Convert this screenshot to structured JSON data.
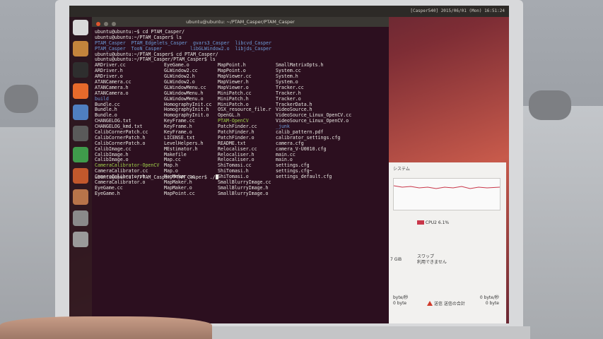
{
  "topbar": {
    "status": "[Casper540] 2015/06/01 (Mon) 16:51:24"
  },
  "launcher": {
    "items": [
      "ubuntu-logo-icon",
      "files-icon",
      "terminal-icon",
      "firefox-icon",
      "libreoffice-writer-icon",
      "system-monitor-icon",
      "libreoffice-calc-icon",
      "libreoffice-impress-icon",
      "software-center-icon",
      "settings-icon",
      "trash-icon"
    ],
    "colors": [
      "#d9d9d9",
      "#c3843c",
      "#2e2e2e",
      "#e66a2b",
      "#4f7fc1",
      "#5a5a5a",
      "#3f9b4b",
      "#c2582c",
      "#b8744a",
      "#8a8a8a",
      "#9a9a9a"
    ]
  },
  "terminal": {
    "title": "ubuntu@ubuntu: ~/PTAM_Casper/PTAM_Casper",
    "lines_top": [
      "ubuntu@ubuntu:~$ cd PTAM_Casper/",
      "ubuntu@ubuntu:~/PTAM_Casper$ ls"
    ],
    "ls1": [
      {
        "text": "PTAM_Casper  PTAM_Edgelets_Casper  gvars3_Casper  libcvd_Casper",
        "cls": "blue"
      },
      {
        "text": "PTAM_Casper  TooN_Casper          libGLWindow2.o  libjds_Casper",
        "cls": "blue"
      }
    ],
    "lines_mid": [
      "ubuntu@ubuntu:~/PTAM_Casper$ cd PTAM_Casper/",
      "ubuntu@ubuntu:~/PTAM_Casper/PTAM_Casper$ ls"
    ],
    "columns": [
      [
        {
          "t": "ARDriver.cc"
        },
        {
          "t": "ARDriver.h"
        },
        {
          "t": "ARDriver.o"
        },
        {
          "t": "ATANCamera.cc"
        },
        {
          "t": "ATANCamera.h"
        },
        {
          "t": "ATANCamera.o"
        },
        {
          "t": "build",
          "c": "blue"
        },
        {
          "t": "Bundle.cc"
        },
        {
          "t": "Bundle.h"
        },
        {
          "t": "Bundle.o"
        },
        {
          "t": "CHANGELOG.txt"
        },
        {
          "t": "CHANGELOG_kmd.txt"
        },
        {
          "t": "CalibCornerPatch.cc"
        },
        {
          "t": "CalibCornerPatch.h"
        },
        {
          "t": "CalibCornerPatch.o"
        },
        {
          "t": "CalibImage.cc"
        },
        {
          "t": "CalibImage.h"
        },
        {
          "t": "CalibImage.o"
        },
        {
          "t": "CameraCalibrator-OpenCV",
          "c": "green"
        },
        {
          "t": "CameraCalibrator.cc"
        },
        {
          "t": "CameraCalibrator.h"
        },
        {
          "t": "CameraCalibrator.o"
        },
        {
          "t": "EyeGame.cc"
        },
        {
          "t": "EyeGame.h"
        }
      ],
      [
        {
          "t": "EyeGame.o"
        },
        {
          "t": "GLWindow2.cc"
        },
        {
          "t": "GLWindow2.h"
        },
        {
          "t": "GLWindow2.o"
        },
        {
          "t": "GLWindowMenu.cc"
        },
        {
          "t": "GLWindowMenu.h"
        },
        {
          "t": "GLWindowMenu.o"
        },
        {
          "t": "HomographyInit.cc"
        },
        {
          "t": "HomographyInit.h"
        },
        {
          "t": "HomographyInit.o"
        },
        {
          "t": "KeyFrame.cc"
        },
        {
          "t": "KeyFrame.h"
        },
        {
          "t": "KeyFrame.o"
        },
        {
          "t": "LICENSE.txt"
        },
        {
          "t": "LevelHelpers.h"
        },
        {
          "t": "MEstimator.h"
        },
        {
          "t": "Makefile"
        },
        {
          "t": "Map.cc"
        },
        {
          "t": "Map.h"
        },
        {
          "t": "Map.o"
        },
        {
          "t": "MapMaker.cc"
        },
        {
          "t": "MapMaker.h"
        },
        {
          "t": "MapMaker.o"
        },
        {
          "t": "MapPoint.cc"
        }
      ],
      [
        {
          "t": "MapPoint.h"
        },
        {
          "t": "MapPoint.o"
        },
        {
          "t": "MapViewer.cc"
        },
        {
          "t": "MapViewer.h"
        },
        {
          "t": "MapViewer.o"
        },
        {
          "t": "MiniPatch.cc"
        },
        {
          "t": "MiniPatch.h"
        },
        {
          "t": "MiniPatch.o"
        },
        {
          "t": "OSX_resource_file.r"
        },
        {
          "t": "OpenGL.h"
        },
        {
          "t": "PTAM-OpenCV",
          "c": "green"
        },
        {
          "t": "PatchFinder.cc"
        },
        {
          "t": "PatchFinder.h"
        },
        {
          "t": "PatchFinder.o"
        },
        {
          "t": "README.txt"
        },
        {
          "t": "Relocaliser.cc"
        },
        {
          "t": "Relocaliser.h"
        },
        {
          "t": "Relocaliser.o"
        },
        {
          "t": "ShiTomasi.cc"
        },
        {
          "t": "ShiTomasi.h"
        },
        {
          "t": "ShiTomasi.o"
        },
        {
          "t": "SmallBlurryImage.cc"
        },
        {
          "t": "SmallBlurryImage.h"
        },
        {
          "t": "SmallBlurryImage.o"
        }
      ],
      [
        {
          "t": "SmallMatrixOpts.h"
        },
        {
          "t": "System.cc"
        },
        {
          "t": "System.h"
        },
        {
          "t": "System.o"
        },
        {
          "t": "Tracker.cc"
        },
        {
          "t": "Tracker.h"
        },
        {
          "t": "Tracker.o"
        },
        {
          "t": "TrackerData.h"
        },
        {
          "t": "VideoSource.h"
        },
        {
          "t": "VideoSource_Linux_OpenCV.cc"
        },
        {
          "t": "VideoSource_Linux_OpenCV.o"
        },
        {
          "t": "_junk",
          "c": "blue"
        },
        {
          "t": "calib_pattern.pdf"
        },
        {
          "t": "calibrator_settings.cfg"
        },
        {
          "t": "camera.cfg"
        },
        {
          "t": "camera_V-U0010.cfg"
        },
        {
          "t": "main.cc"
        },
        {
          "t": "main.o"
        },
        {
          "t": "settings.cfg"
        },
        {
          "t": "settings.cfg~"
        },
        {
          "t": "settings_default.cfg"
        }
      ]
    ],
    "prompt_last": "ubuntu@ubuntu:~/PTAM_Casper/PTAM_Casper$ ./"
  },
  "monitor": {
    "header": "システム",
    "cpu_legend": "CPU2  6.1%",
    "swap_label": "スワップ",
    "swap_value": "利用できません",
    "mem_value": "7 GiB",
    "net_send_label": "送信",
    "net_send_total": "送信の合計",
    "net_rate_left": "byte/秒",
    "net_total_left": "0 byte",
    "net_rate_right": "0 byte/秒",
    "net_total_right": "0 byte"
  }
}
